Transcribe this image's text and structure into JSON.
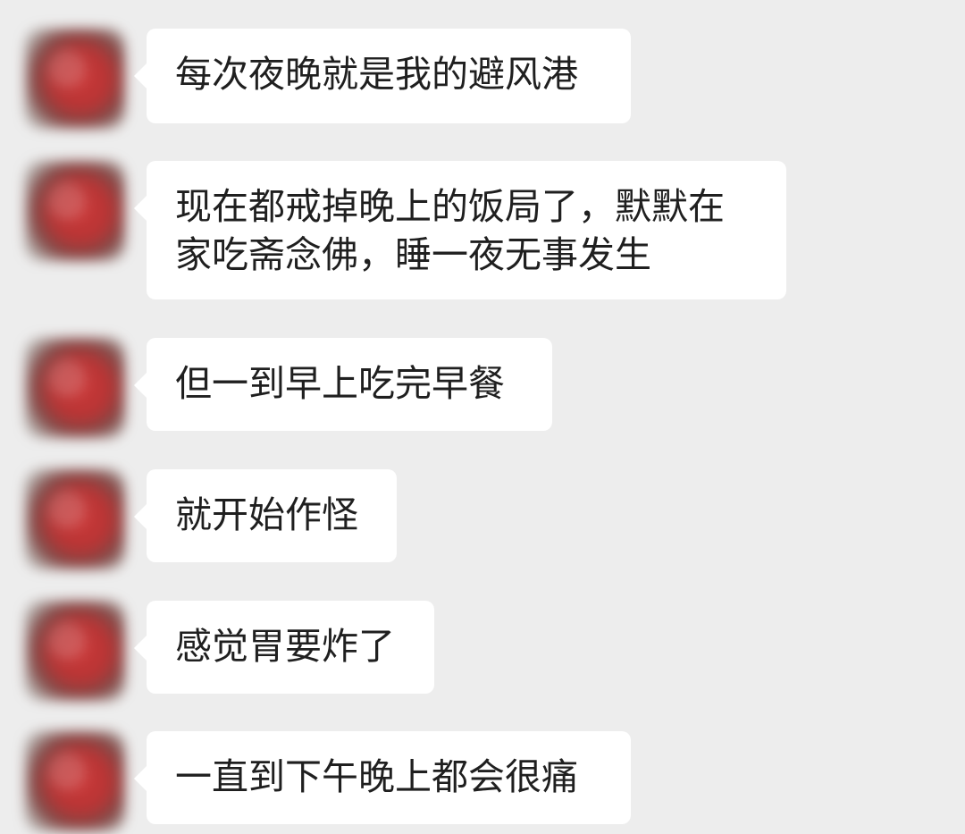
{
  "messages": [
    {
      "text": "每次夜晚就是我的避风港"
    },
    {
      "text": "现在都戒掉晚上的饭局了，默默在\n家吃斋念佛，睡一夜无事发生"
    },
    {
      "text": "但一到早上吃完早餐"
    },
    {
      "text": "就开始作怪"
    },
    {
      "text": "感觉胃要炸了"
    },
    {
      "text": "一直到下午晚上都会很痛"
    }
  ]
}
